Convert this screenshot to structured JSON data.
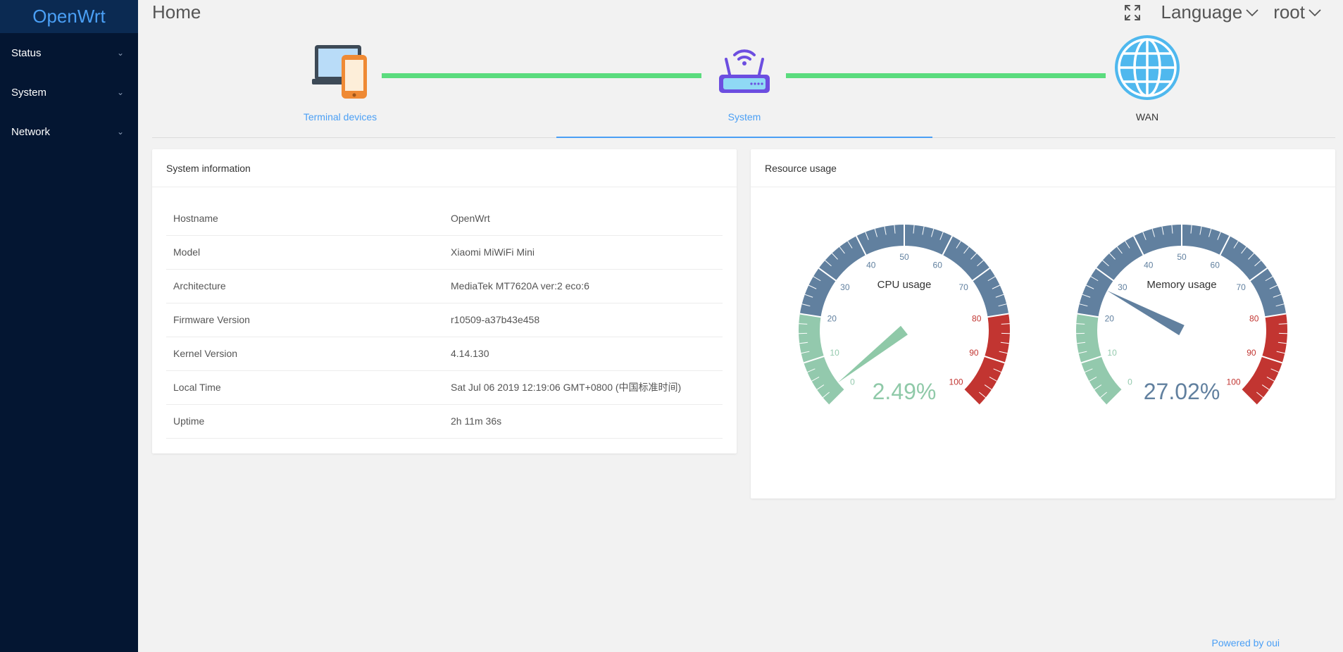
{
  "brand": "OpenWrt",
  "nav": [
    {
      "label": "Status"
    },
    {
      "label": "System"
    },
    {
      "label": "Network"
    }
  ],
  "header": {
    "title": "Home",
    "language": "Language",
    "user": "root"
  },
  "topology": {
    "nodes": [
      {
        "label": "Terminal devices",
        "icon": "devices-icon"
      },
      {
        "label": "System",
        "icon": "router-icon"
      },
      {
        "label": "WAN",
        "icon": "globe-icon"
      }
    ],
    "active": 1
  },
  "system_info": {
    "title": "System information",
    "rows": [
      {
        "key": "Hostname",
        "value": "OpenWrt"
      },
      {
        "key": "Model",
        "value": "Xiaomi MiWiFi Mini"
      },
      {
        "key": "Architecture",
        "value": "MediaTek MT7620A ver:2 eco:6"
      },
      {
        "key": "Firmware Version",
        "value": "r10509-a37b43e458"
      },
      {
        "key": "Kernel Version",
        "value": "4.14.130"
      },
      {
        "key": "Local Time",
        "value": "Sat Jul 06 2019 12:19:06 GMT+0800 (中国标准时间)"
      },
      {
        "key": "Uptime",
        "value": "2h 11m 36s"
      }
    ]
  },
  "resource": {
    "title": "Resource usage",
    "gauges": [
      {
        "label": "CPU usage",
        "value": 2.49,
        "display": "2.49%",
        "color": "#8fc9a8"
      },
      {
        "label": "Memory usage",
        "value": 27.02,
        "display": "27.02%",
        "color": "#61809f"
      }
    ],
    "ticks": [
      "0",
      "10",
      "20",
      "30",
      "40",
      "50",
      "60",
      "70",
      "80",
      "90",
      "100"
    ],
    "colors": {
      "low": "#93c9ad",
      "mid": "#61809f",
      "high": "#c23531"
    }
  },
  "footer": "Powered by oui"
}
